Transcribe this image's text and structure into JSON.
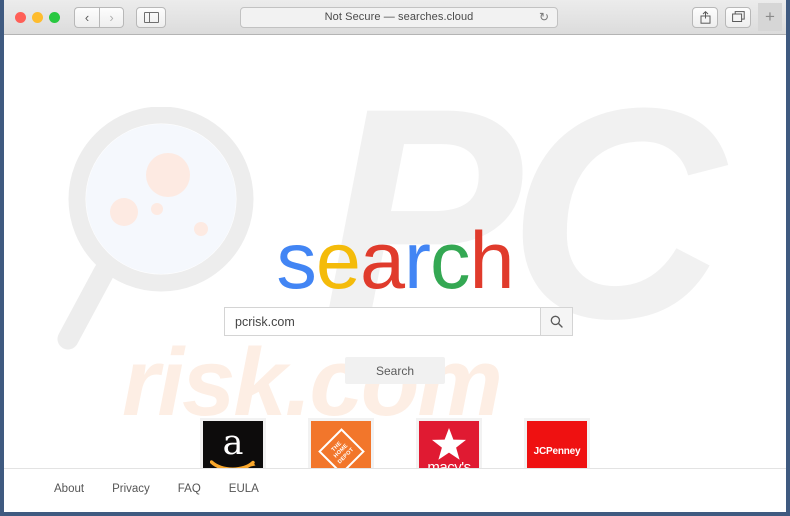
{
  "browser": {
    "traffic_lights": [
      {
        "name": "close",
        "color": "#ff5f57"
      },
      {
        "name": "minimize",
        "color": "#febc2e"
      },
      {
        "name": "zoom",
        "color": "#28c840"
      }
    ],
    "back_glyph": "‹",
    "forward_glyph": "›",
    "address": "Not Secure — searches.cloud",
    "reload_glyph": "↻",
    "new_tab_glyph": "+",
    "frame_color": "#3f5a80"
  },
  "watermark": {
    "pc_text": "PC",
    "risk_text": "risk.com",
    "pc_color": "#f1f1f1",
    "risk_color": "#fdeee4",
    "glass_color": "#ededed"
  },
  "logo": {
    "letters": [
      {
        "char": "s",
        "color": "#4285f4"
      },
      {
        "char": "e",
        "color": "#f4bb0a"
      },
      {
        "char": "a",
        "color": "#e03b2c"
      },
      {
        "char": "r",
        "color": "#4285f4"
      },
      {
        "char": "c",
        "color": "#34a853"
      },
      {
        "char": "h",
        "color": "#e03b2c"
      }
    ],
    "text": "search"
  },
  "search": {
    "value": "pcrisk.com",
    "placeholder": "",
    "go_icon": "search-icon",
    "button_label": "Search"
  },
  "tiles": [
    {
      "name": "amazon",
      "label": "amazon",
      "bg": "#0d0c0c",
      "letter": "a",
      "accent": "#f9a72b"
    },
    {
      "name": "home-depot",
      "label": "THE HOME DEPOT",
      "bg": "#f2762b",
      "line1": "THE",
      "line2": "HOME",
      "line3": "DEPOT"
    },
    {
      "name": "macys",
      "label": "macy's",
      "bg": "#e01a32"
    },
    {
      "name": "jcpenney",
      "label": "JCPenney",
      "bg": "#ef1111"
    }
  ],
  "footer": {
    "links": [
      {
        "label": "About"
      },
      {
        "label": "Privacy"
      },
      {
        "label": "FAQ"
      },
      {
        "label": "EULA"
      }
    ]
  }
}
